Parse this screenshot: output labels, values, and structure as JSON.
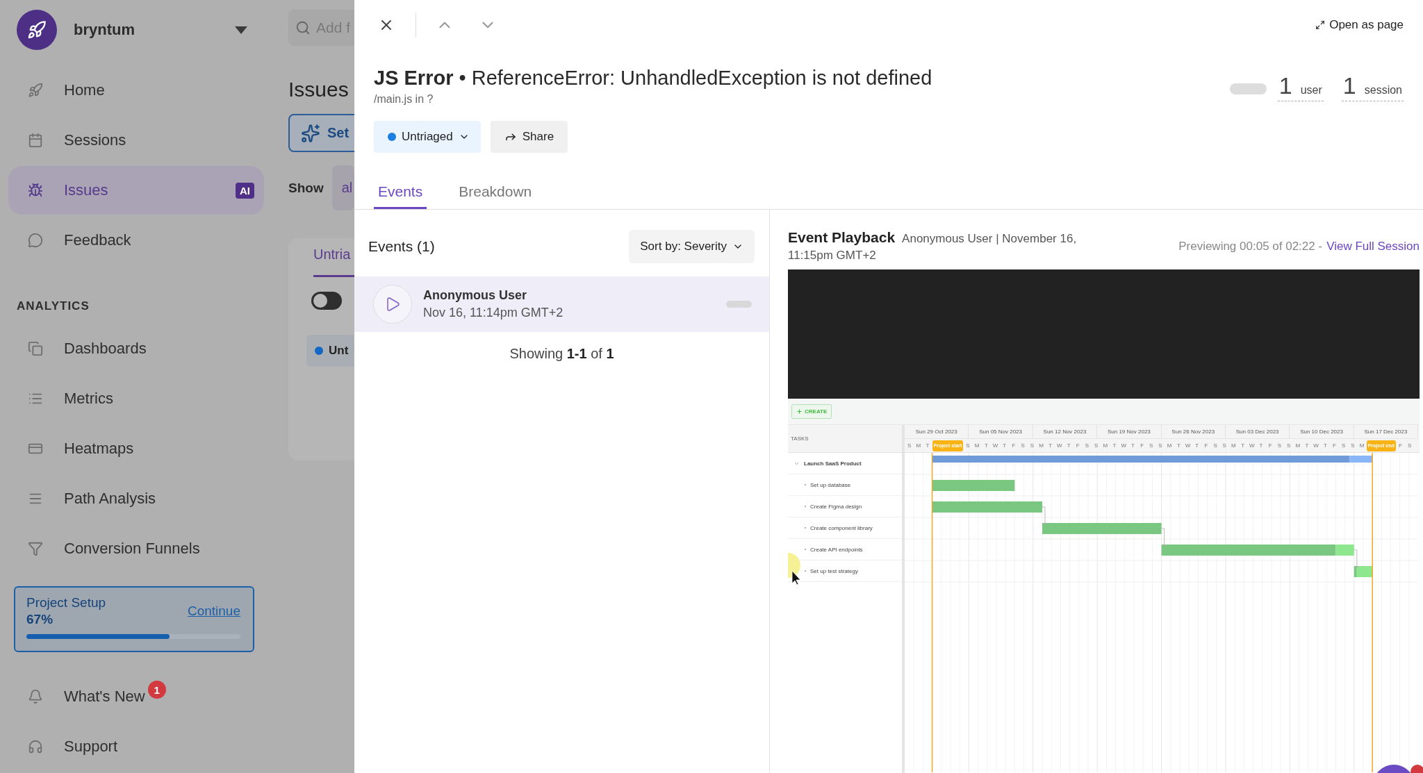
{
  "sidebar": {
    "workspace": "bryntum",
    "nav": [
      {
        "label": "Home",
        "selected": false
      },
      {
        "label": "Sessions",
        "selected": false
      },
      {
        "label": "Issues",
        "selected": true,
        "badge": "AI"
      },
      {
        "label": "Feedback",
        "selected": false
      }
    ],
    "section": "ANALYTICS",
    "analytics": [
      {
        "label": "Dashboards",
        "selected": false
      },
      {
        "label": "Metrics",
        "selected": false
      },
      {
        "label": "Heatmaps",
        "selected": false
      },
      {
        "label": "Path Analysis",
        "selected": false
      },
      {
        "label": "Conversion Funnels",
        "selected": false
      }
    ],
    "project_setup": {
      "title": "Project Setup",
      "percent": "67%",
      "action": "Continue",
      "level": 0.67
    },
    "footer": [
      {
        "label": "What's New",
        "badge": "1"
      },
      {
        "label": "Support"
      }
    ]
  },
  "background_page": {
    "search_placeholder": "Add f",
    "heading": "Issues",
    "setup_button": "Set",
    "show_label": "Show",
    "filter": "al",
    "tab": "Untria",
    "toggle": {
      "on": false
    },
    "status_pill": "Unt"
  },
  "drawer": {
    "open_as_page": "Open as page",
    "title": "**JS Error** • ReferenceError: UnhandledException is not defined",
    "location": "/main.js in ?",
    "status": "Untriaged",
    "share": "Share",
    "stats": [
      {
        "value": "1",
        "unit": "user"
      },
      {
        "value": "1",
        "unit": "session"
      }
    ],
    "tabs": [
      {
        "label": "Events",
        "selected": true
      },
      {
        "label": "Breakdown",
        "selected": false
      }
    ],
    "events": {
      "heading": "Events (1)",
      "sort": "Sort by: Severity",
      "rows": [
        {
          "user": "Anonymous User",
          "time": "Nov 16, 11:14pm GMT+2",
          "selected": true
        }
      ],
      "pagination": "Showing **1-1** of **1**"
    },
    "playback": {
      "title": "Event Playback",
      "meta": "Anonymous User | November 16, 11:15pm GMT+2",
      "preview": "Previewing 00:05 of 02:22 -",
      "link": "View Full Session",
      "replay": {
        "create": "CREATE",
        "tasks_heading": "TASKS",
        "weeks": [
          "Sun 29 Oct 2023",
          "Sun 05 Nov 2023",
          "Sun 12 Nov 2023",
          "Sun 19 Nov 2023",
          "Sun 26 Nov 2023",
          "Sun 03 Dec 2023",
          "Sun 10 Dec 2023",
          "Sun 17 Dec 2023"
        ],
        "days": [
          {
            "kind": "day",
            "label": "S"
          },
          {
            "kind": "day",
            "label": "M"
          },
          {
            "kind": "day",
            "label": "T"
          },
          {
            "kind": "marker",
            "label": "Project start"
          },
          {
            "kind": "day",
            "label": "S"
          },
          {
            "kind": "day",
            "label": "M"
          },
          {
            "kind": "day",
            "label": "T"
          },
          {
            "kind": "day",
            "label": "W"
          },
          {
            "kind": "day",
            "label": "T"
          },
          {
            "kind": "day",
            "label": "F"
          },
          {
            "kind": "day",
            "label": "S"
          },
          {
            "kind": "day",
            "label": "S"
          },
          {
            "kind": "day",
            "label": "M"
          },
          {
            "kind": "day",
            "label": "T"
          },
          {
            "kind": "day",
            "label": "W"
          },
          {
            "kind": "day",
            "label": "T"
          },
          {
            "kind": "day",
            "label": "F"
          },
          {
            "kind": "day",
            "label": "S"
          },
          {
            "kind": "day",
            "label": "S"
          },
          {
            "kind": "day",
            "label": "M"
          },
          {
            "kind": "day",
            "label": "T"
          },
          {
            "kind": "day",
            "label": "W"
          },
          {
            "kind": "day",
            "label": "T"
          },
          {
            "kind": "day",
            "label": "F"
          },
          {
            "kind": "day",
            "label": "S"
          },
          {
            "kind": "day",
            "label": "S"
          },
          {
            "kind": "day",
            "label": "M"
          },
          {
            "kind": "day",
            "label": "T"
          },
          {
            "kind": "day",
            "label": "W"
          },
          {
            "kind": "day",
            "label": "T"
          },
          {
            "kind": "day",
            "label": "F"
          },
          {
            "kind": "day",
            "label": "S"
          },
          {
            "kind": "day",
            "label": "S"
          },
          {
            "kind": "day",
            "label": "M"
          },
          {
            "kind": "day",
            "label": "T"
          },
          {
            "kind": "day",
            "label": "W"
          },
          {
            "kind": "day",
            "label": "T"
          },
          {
            "kind": "day",
            "label": "F"
          },
          {
            "kind": "day",
            "label": "S"
          },
          {
            "kind": "day",
            "label": "S"
          },
          {
            "kind": "day",
            "label": "M"
          },
          {
            "kind": "day",
            "label": "T"
          },
          {
            "kind": "day",
            "label": "W"
          },
          {
            "kind": "day",
            "label": "T"
          },
          {
            "kind": "day",
            "label": "F"
          },
          {
            "kind": "day",
            "label": "S"
          },
          {
            "kind": "day",
            "label": "S"
          },
          {
            "kind": "day",
            "label": "M"
          },
          {
            "kind": "marker",
            "label": "Project end"
          },
          {
            "kind": "day",
            "label": "F"
          },
          {
            "kind": "day",
            "label": "S"
          }
        ],
        "tasks": [
          {
            "label": "Launch SaaS Product",
            "expanded": true,
            "children": [
              {
                "label": "Set up database"
              },
              {
                "label": "Create Figma design"
              },
              {
                "label": "Create component library"
              },
              {
                "label": "Create API endpoints"
              },
              {
                "label": "Set up test strategy"
              }
            ]
          }
        ]
      }
    }
  }
}
